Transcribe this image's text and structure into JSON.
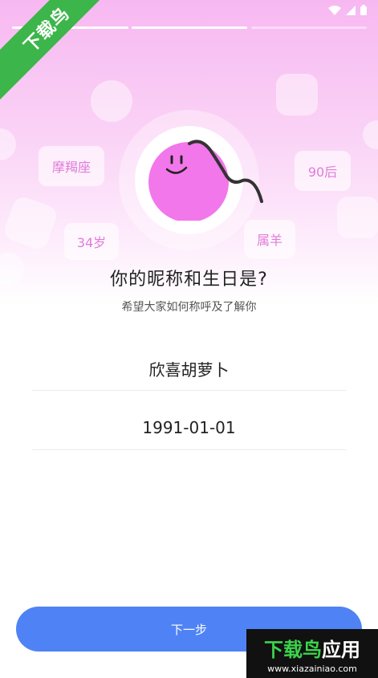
{
  "status_bar": {
    "wifi_icon": "wifi-icon",
    "signal_icon": "signal-icon",
    "battery_icon": "battery-icon"
  },
  "progress": {
    "current_step": 2,
    "total_steps": 3
  },
  "corner_banner": {
    "text": "下载鸟"
  },
  "tags": {
    "zodiac": "摩羯座",
    "generation": "90后",
    "age": "34岁",
    "chinese_zodiac": "属羊"
  },
  "heading": {
    "title": "你的昵称和生日是?",
    "subtitle": "希望大家如何称呼及了解你"
  },
  "form": {
    "nickname": "欣喜胡萝卜",
    "birthday": "1991-01-01"
  },
  "next_button": {
    "label": "下一步"
  },
  "watermark": {
    "brand_green": "下载鸟",
    "brand_white": "应用",
    "url": "www.xiazainiao.com"
  },
  "colors": {
    "accent_blue": "#4f83f5",
    "avatar_pink": "#f277ea",
    "tag_text": "#e07bd8",
    "banner_green": "#3cb54a"
  }
}
